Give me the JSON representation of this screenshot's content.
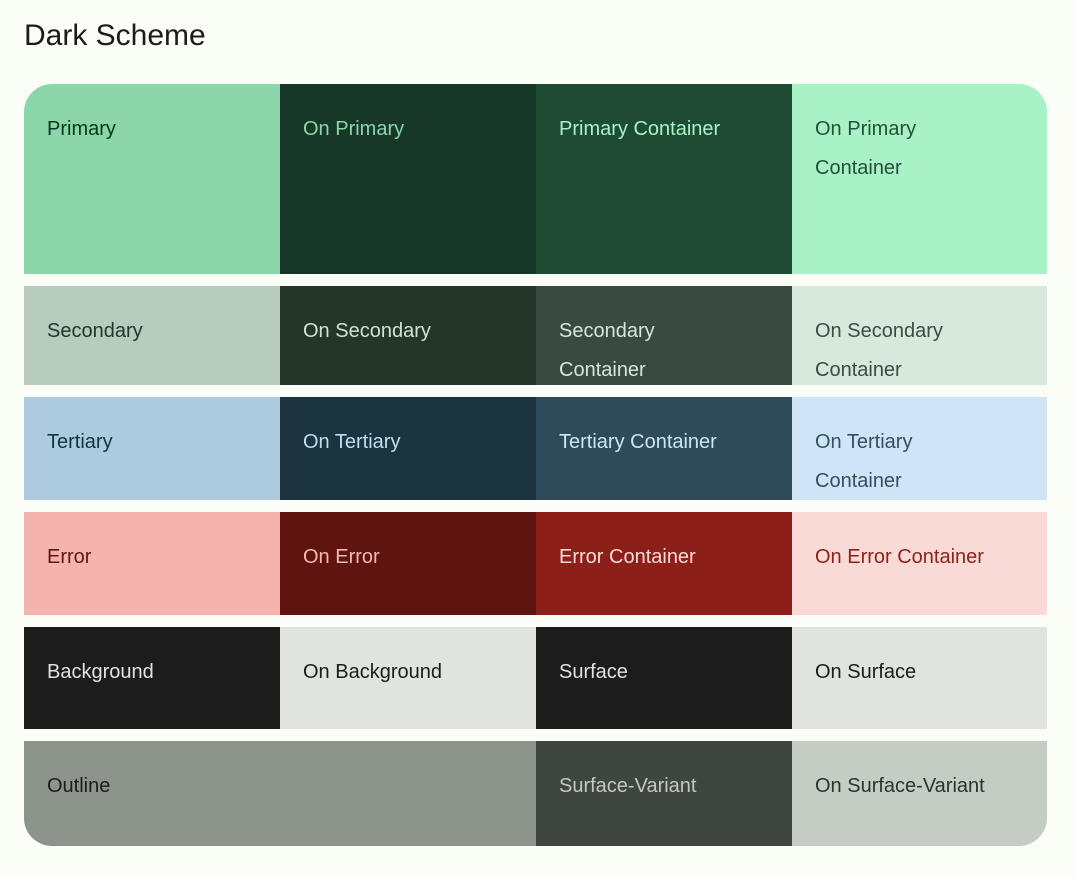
{
  "header": {
    "title": "Dark Scheme",
    "title_color": "#1A1C1A"
  },
  "page": {
    "background_color": "#FBFDF7"
  },
  "swatch_rows": [
    {
      "name": "primary",
      "cells": [
        {
          "label": "Primary",
          "bg": "#8CD6AA",
          "fg": "#00391E"
        },
        {
          "label": "On Primary",
          "bg": "#173828",
          "fg": "#8CD6AA"
        },
        {
          "label": "Primary Container",
          "bg": "#1F4B35",
          "fg": "#A8F2C6"
        },
        {
          "label": "On Primary\nContainer",
          "bg": "#A8F2C6",
          "fg": "#23503A"
        }
      ]
    },
    {
      "name": "secondary",
      "cells": [
        {
          "label": "Secondary",
          "bg": "#B7CCBE",
          "fg": "#24352B"
        },
        {
          "label": "On Secondary",
          "bg": "#253529",
          "fg": "#CDE4D2"
        },
        {
          "label": "Secondary\nContainer",
          "bg": "#394A40",
          "fg": "#D3E8D8"
        },
        {
          "label": "On Secondary\nContainer",
          "bg": "#D7E8DC",
          "fg": "#3B4C42"
        }
      ]
    },
    {
      "name": "tertiary",
      "cells": [
        {
          "label": "Tertiary",
          "bg": "#ADCBDF",
          "fg": "#13333F"
        },
        {
          "label": "On Tertiary",
          "bg": "#1B343F",
          "fg": "#C2DDF0"
        },
        {
          "label": "Tertiary Container",
          "bg": "#2F4A58",
          "fg": "#CDE5F7"
        },
        {
          "label": "On Tertiary\nContainer",
          "bg": "#CFE5F7",
          "fg": "#32505F"
        }
      ]
    },
    {
      "name": "error",
      "cells": [
        {
          "label": "Error",
          "bg": "#F4B4AD",
          "fg": "#641410"
        },
        {
          "label": "On Error",
          "bg": "#601410",
          "fg": "#F4B9B2"
        },
        {
          "label": "Error Container",
          "bg": "#8C2019",
          "fg": "#FADAD6"
        },
        {
          "label": "On Error Container",
          "bg": "#FADAD6",
          "fg": "#8F231C"
        }
      ]
    },
    {
      "name": "background",
      "cells": [
        {
          "label": "Background",
          "bg": "#1B1C1B",
          "fg": "#E2E3E0"
        },
        {
          "label": "On Background",
          "bg": "#E1E3DF",
          "fg": "#1B1C1B"
        },
        {
          "label": "Surface",
          "bg": "#1B1C1B",
          "fg": "#E2E3E0"
        },
        {
          "label": "On Surface",
          "bg": "#E1E3DF",
          "fg": "#1B1C1B"
        }
      ]
    },
    {
      "name": "outline",
      "cells": [
        {
          "label": "Outline",
          "bg": "#8C948C",
          "fg": "#1B1C1B",
          "span": 2
        },
        {
          "label": "Surface-Variant",
          "bg": "#3E463F",
          "fg": "#C3C9C1"
        },
        {
          "label": "On Surface-Variant",
          "bg": "#C5CCC4",
          "fg": "#2C332D"
        }
      ]
    }
  ]
}
